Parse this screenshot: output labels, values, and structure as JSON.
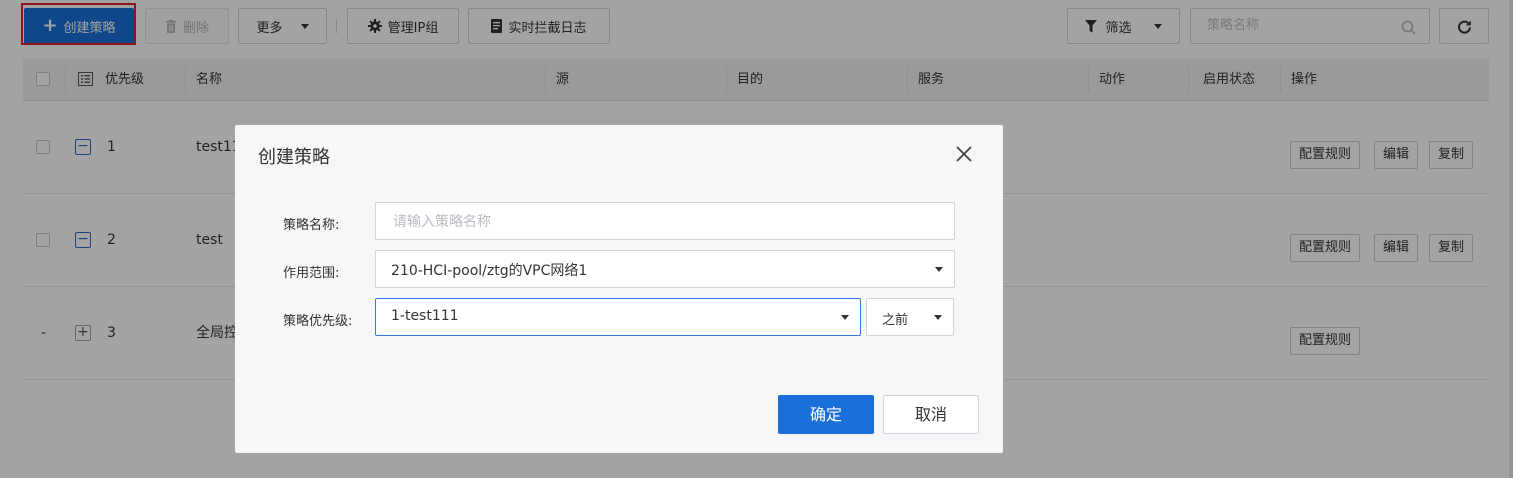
{
  "toolbar": {
    "create_label": "创建策略",
    "delete_label": "删除",
    "more_label": "更多",
    "ipgroup_label": "管理IP组",
    "log_label": "实时拦截日志",
    "filter_label": "筛选",
    "search_placeholder": "策略名称"
  },
  "table": {
    "headers": [
      "优先级",
      "名称",
      "源",
      "目的",
      "服务",
      "动作",
      "启用状态",
      "操作"
    ],
    "rows": [
      {
        "priority": "1",
        "name": "test11",
        "toggle": "−",
        "ops": [
          "配置规则",
          "编辑",
          "复制"
        ]
      },
      {
        "priority": "2",
        "name": "test",
        "toggle": "−",
        "ops": [
          "配置规则",
          "编辑",
          "复制"
        ]
      },
      {
        "priority": "3",
        "name": "全局控",
        "toggle": "+",
        "check": "-",
        "ops": [
          "配置规则"
        ]
      }
    ]
  },
  "modal": {
    "title": "创建策略",
    "name_label": "策略名称:",
    "name_placeholder": "请输入策略名称",
    "scope_label": "作用范围:",
    "scope_value": "210-HCI-pool/ztg的VPC网络1",
    "priority_label": "策略优先级:",
    "priority_value": "1-test111",
    "position_value": "之前",
    "ok_label": "确定",
    "cancel_label": "取消"
  },
  "colors": {
    "primary": "#1a70d8",
    "highlight": "#e0212b"
  }
}
